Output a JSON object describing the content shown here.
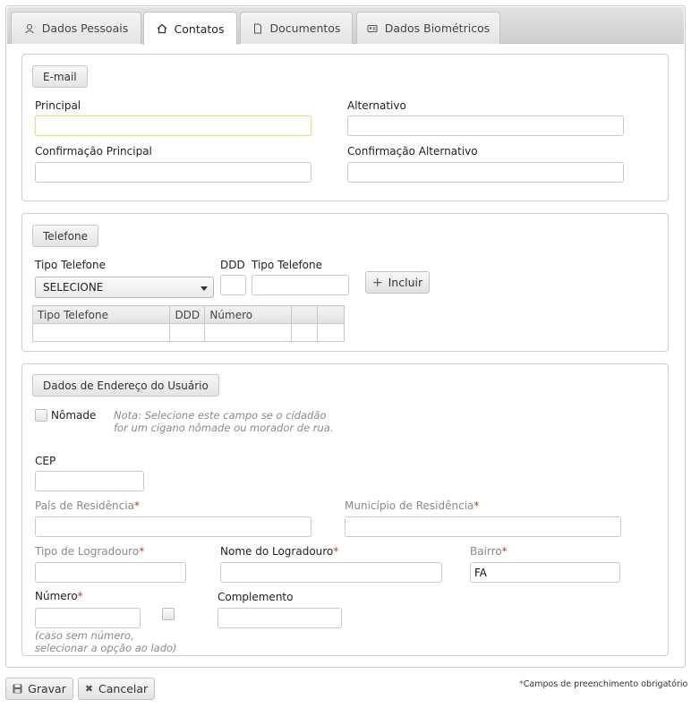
{
  "tabs": [
    {
      "label": "Dados Pessoais",
      "icon": "user-icon",
      "active": false
    },
    {
      "label": "Contatos",
      "icon": "home-icon",
      "active": true
    },
    {
      "label": "Documentos",
      "icon": "document-icon",
      "active": false
    },
    {
      "label": "Dados Biométricos",
      "icon": "id-card-icon",
      "active": false
    }
  ],
  "email": {
    "legend": "E-mail",
    "principal_label": "Principal",
    "principal_value": "",
    "alternativo_label": "Alternativo",
    "alternativo_value": "",
    "conf_principal_label": "Confirmação Principal",
    "conf_principal_value": "",
    "conf_alternativo_label": "Confirmação Alternativo",
    "conf_alternativo_value": ""
  },
  "telefone": {
    "legend": "Telefone",
    "tipo_label": "Tipo Telefone",
    "tipo_selected": "SELECIONE",
    "ddd_label": "DDD",
    "tipo2_label": "Tipo Telefone",
    "add_label": "Incluir",
    "table_headers": [
      "Tipo Telefone",
      "DDD",
      "Número",
      "",
      ""
    ]
  },
  "endereco": {
    "legend": "Dados de Endereço do Usuário",
    "nomade_label": "Nômade",
    "note_line1": "Nota: Selecione este campo se o cidadão",
    "note_line2": "for um cigano nômade ou morador de rua.",
    "cep_label": "CEP",
    "pais_label": "País de Residência",
    "municipio_label": "Município de Residência",
    "tipo_logradouro_label": "Tipo de Logradouro",
    "nome_logradouro_label": "Nome do Logradouro",
    "bairro_label": "Bairro",
    "bairro_value": "FA",
    "numero_label": "Número",
    "complemento_label": "Complemento",
    "numero_hint_line1": "(caso sem número,",
    "numero_hint_line2": "selecionar a opção ao lado)",
    "required_mark": "*"
  },
  "footer": {
    "save_label": "Gravar",
    "cancel_label": "Cancelar",
    "required_note": "Campos de preenchimento obrigatório",
    "required_mark": "*"
  }
}
